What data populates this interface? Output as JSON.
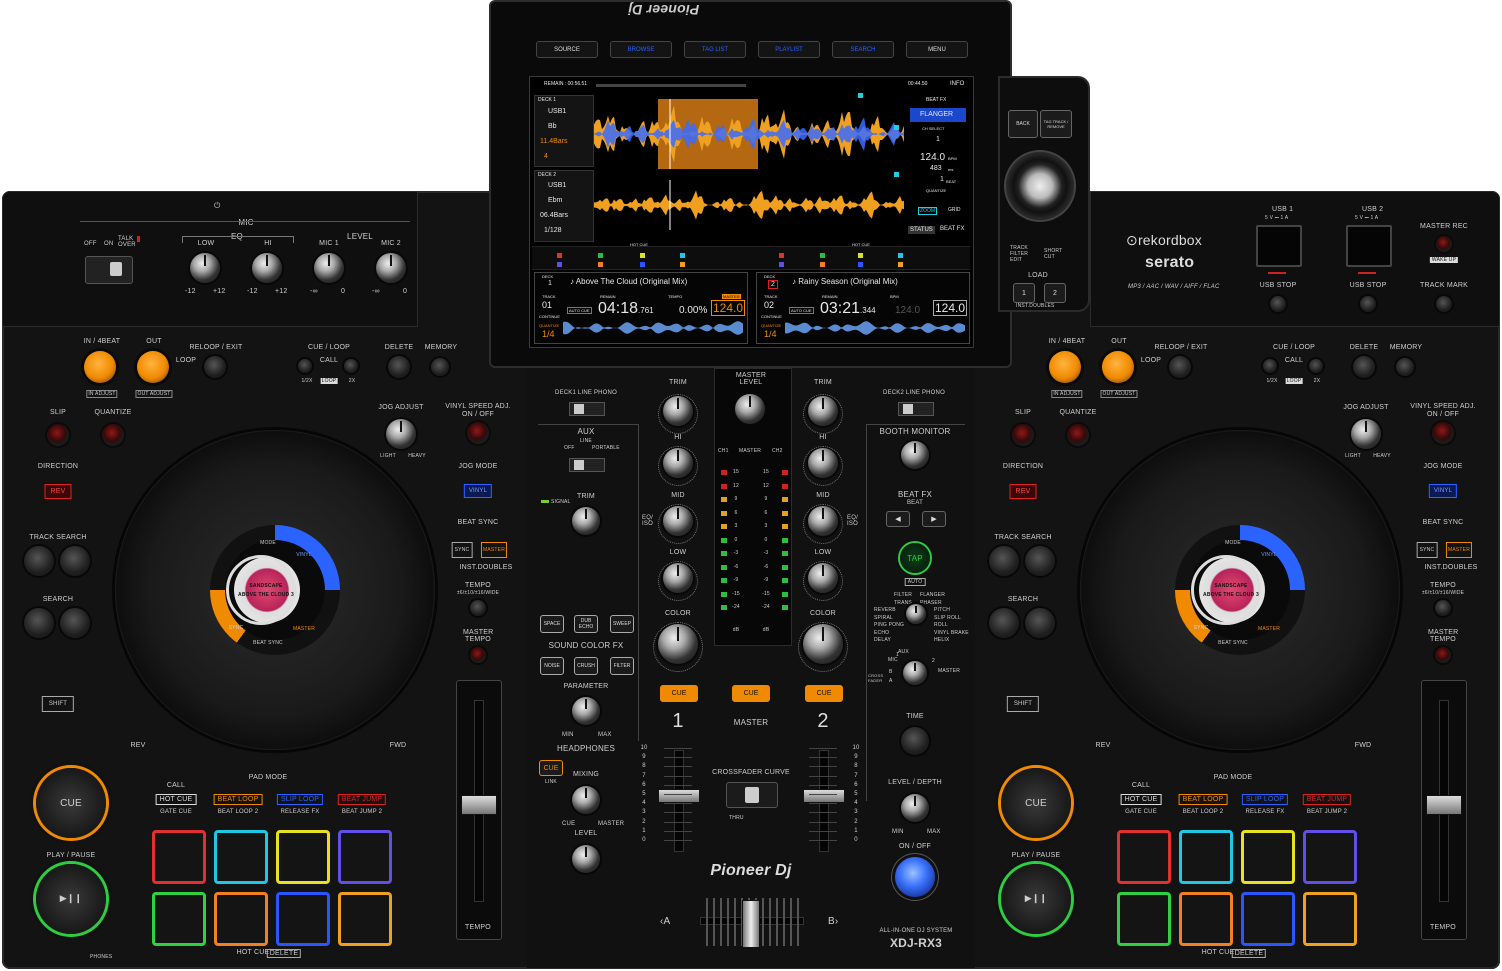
{
  "screen": {
    "brand_flip": "Pioneer Dj",
    "top_buttons": [
      "SOURCE",
      "BROWSE",
      "TAG LIST",
      "PLAYLIST",
      "SEARCH",
      "MENU"
    ],
    "remain_top": "REMAIN : 00:56.51",
    "time_top": "00:44.50",
    "info": "INFO",
    "deck1": {
      "label": "DECK 1",
      "source": "USB1",
      "key": "Bb",
      "bars": "11.4Bars",
      "loop": "4"
    },
    "deck2": {
      "label": "DECK 2",
      "source": "USB1",
      "key": "Ebm",
      "bars": "06.4Bars",
      "loop": "1/128"
    },
    "beat_fx": "BEAT FX",
    "flanger": "FLANGER",
    "ch_select": "CH SELECT",
    "ch_value": "1",
    "bpm_val": "124.0",
    "bpm_unit": "BPM",
    "ms_val": "483",
    "ms_unit": "ms",
    "beat_val": "1",
    "beat_unit": "BEAT",
    "quantize": "QUANTIZE",
    "zoom": "ZOOM",
    "grid": "GRID",
    "status": "STATUS",
    "beatfx2": "BEAT FX",
    "hotcue1": "HOT CUE",
    "hotcue2": "HOT CUE",
    "track1": {
      "deck": "DECK",
      "num": "1",
      "title": "Above The Cloud (Original Mix)",
      "track_lbl": "TRACK",
      "track": "01",
      "continue": "CONTINUE",
      "quantize": "QUANTIZE",
      "fraction": "1/4",
      "auto_cue": "AUTO CUE",
      "time": "04:18",
      "time_sub": ".761",
      "tempo": "0.00%",
      "bpm": "124.0",
      "remain": "REMAIN",
      "tempo_lbl": "TEMPO",
      "master": "MASTER"
    },
    "track2": {
      "deck": "DECK",
      "num": "2",
      "title": "Rainy Season (Original Mix)",
      "track_lbl": "TRACK",
      "track": "02",
      "continue": "CONTINUE",
      "quantize": "QUANTIZE",
      "fraction": "1/4",
      "auto_cue": "AUTO CUE",
      "time": "03:21",
      "time_sub": ".344",
      "tempo": "124.0",
      "bpm": "124.0",
      "remain": "REMAIN",
      "tempo_lbl": "BPM"
    }
  },
  "browse": {
    "back": "BACK",
    "tag_track": "TAG TRACK / REMOVE",
    "track_filter": "TRACK FILTER EDIT",
    "short_cut": "SHORT CUT",
    "load": "LOAD",
    "load1": "1",
    "load2": "2",
    "inst_doubles": "INST.DOUBLES"
  },
  "mic": {
    "power": "⏻",
    "mic": "MIC",
    "talk_over": "TALK OVER",
    "off": "OFF",
    "on": "ON",
    "eq": "EQ",
    "level": "LEVEL",
    "low": "LOW",
    "hi": "HI",
    "mic1": "MIC 1",
    "mic2": "MIC 2",
    "m12": "-12",
    "p12": "+12",
    "min": "-∞",
    "zero": "0"
  },
  "brand": {
    "rekordbox": "rekordbox",
    "serato": "serato",
    "formats": "MP3 / AAC / WAV / AIFF / FLAC",
    "usb1": "USB 1",
    "usb2": "USB 2",
    "usb_pwr": "5 V ⎓ 1 A",
    "usb_stop": "USB STOP",
    "master_rec": "MASTER REC",
    "wake_up": "WAKE UP",
    "track_mark": "TRACK MARK"
  },
  "deck": {
    "in_4beat": "IN / 4BEAT",
    "out": "OUT",
    "reloop_exit": "RELOOP / EXIT",
    "loop": "LOOP",
    "in_adjust": "IN ADJUST",
    "out_adjust": "OUT ADJUST",
    "cue_loop": "CUE / LOOP",
    "call": "CALL",
    "half": "1/2X",
    "loop2": "LOOP",
    "double": "2X",
    "delete": "DELETE",
    "memory": "MEMORY",
    "slip": "SLIP",
    "quantize": "QUANTIZE",
    "jog_adjust": "JOG ADJUST",
    "light": "LIGHT",
    "heavy": "HEAVY",
    "vinyl_speed": "VINYL SPEED ADJ.",
    "on_off": "ON / OFF",
    "direction": "DIRECTION",
    "rev": "REV",
    "jog_mode": "JOG MODE",
    "vinyl": "VINYL",
    "beat_sync": "BEAT SYNC",
    "sync": "SYNC",
    "master": "MASTER",
    "inst_doubles": "INST.DOUBLES",
    "track_search": "TRACK SEARCH",
    "search": "SEARCH",
    "tempo": "TEMPO",
    "tempo_range": "±6/±10/±16/WIDE",
    "master_tempo": "MASTER TEMPO",
    "shift": "SHIFT",
    "rev2": "REV",
    "fwd": "FWD",
    "cue": "CUE",
    "play_pause": "PLAY / PAUSE",
    "pad_mode": "PAD MODE",
    "call2": "CALL",
    "hot_cue": "HOT CUE",
    "beat_loop": "BEAT LOOP",
    "slip_loop": "SLIP LOOP",
    "beat_jump": "BEAT JUMP",
    "gate_cue": "GATE CUE",
    "beat_loop2": "BEAT LOOP 2",
    "release_fx": "RELEASE FX",
    "beat_jump2": "BEAT JUMP 2",
    "hotcue_delete": "HOT CUE",
    "delete2": "DELETE",
    "tempo2": "TEMPO",
    "jog_mode_txt": "MODE",
    "jog_vinyl": "VINYL",
    "jog_sync": "SYNC",
    "jog_beat_sync": "BEAT SYNC",
    "jog_master": "MASTER",
    "jog_track": "SANDSCAPE",
    "jog_track2": "ABOVE THE CLOUD 3",
    "phones": "PHONES"
  },
  "mixer": {
    "deck1": "DECK1",
    "deck2": "DECK2",
    "line": "LINE",
    "phono": "PHONO",
    "trim": "TRIM",
    "master_level": "MASTER LEVEL",
    "aux": "AUX",
    "aux_line": "LINE",
    "aux_off": "OFF",
    "aux_portable": "PORTABLE",
    "signal": "SIGNAL",
    "hi": "HI",
    "mid": "MID",
    "low": "LOW",
    "eq_iso": "EQ/ ISO",
    "color": "COLOR",
    "cue": "CUE",
    "ch1": "1",
    "ch2": "2",
    "master": "MASTER",
    "ch1_lbl": "CH1",
    "master_lbl": "MASTER",
    "ch2_lbl": "CH2",
    "meter_vals": [
      "15",
      "12",
      "9",
      "6",
      "3",
      "0",
      "-3",
      "-6",
      "-9",
      "-15",
      "-24"
    ],
    "db": "dB",
    "space": "SPACE",
    "dub_echo": "DUB ECHO",
    "sweep": "SWEEP",
    "sound_color_fx": "SOUND COLOR FX",
    "noise": "NOISE",
    "crush": "CRUSH",
    "filter": "FILTER",
    "parameter": "PARAMETER",
    "min": "MIN",
    "max": "MAX",
    "headphones": "HEADPHONES",
    "hp_cue": "CUE",
    "link": "LINK",
    "mixing": "MIXING",
    "hp_cue2": "CUE",
    "hp_master": "MASTER",
    "level": "LEVEL",
    "crossfader_curve": "CROSSFADER CURVE",
    "thru": "THRU",
    "fader_scale": [
      "10",
      "9",
      "8",
      "7",
      "6",
      "5",
      "4",
      "3",
      "2",
      "1",
      "0"
    ],
    "brand": "Pioneer Dj",
    "a": "‹A",
    "b": "B›",
    "booth_monitor": "BOOTH MONITOR",
    "beat_fx": "BEAT FX",
    "beat": "BEAT",
    "tap": "TAP",
    "auto": "AUTO",
    "fx_list_left": [
      "FILTER",
      "TRANS",
      "REVERB",
      "SPIRAL",
      "PING PONG",
      "ECHO",
      "DELAY"
    ],
    "fx_list_right": [
      "FLANGER",
      "PHASER",
      "PITCH",
      "SLIP ROLL",
      "ROLL",
      "VINYL BRAKE",
      "HELIX"
    ],
    "fx_mic": "MIC",
    "fx_aux": "AUX",
    "fx_1": "1",
    "fx_2": "2",
    "fx_master": "MASTER",
    "fx_b": "B",
    "fx_a": "A",
    "cross_fader": "CROSS FADER",
    "time": "TIME",
    "level_depth": "LEVEL / DEPTH",
    "on_off": "ON / OFF",
    "system": "ALL-IN-ONE DJ SYSTEM",
    "model": "XDJ-RX3"
  },
  "colors": {
    "orange": "#f08a00",
    "red": "#d42020",
    "blue": "#2a63ff",
    "green": "#2ecc40",
    "pad_red": "#e03030",
    "pad_cyan": "#20c8e8",
    "pad_yellow": "#e8e020",
    "pad_purple": "#6050e8",
    "pad_green": "#30d040",
    "pad_orange": "#f08020",
    "pad_blue": "#2a55ff",
    "pad_amber": "#f0a020"
  }
}
